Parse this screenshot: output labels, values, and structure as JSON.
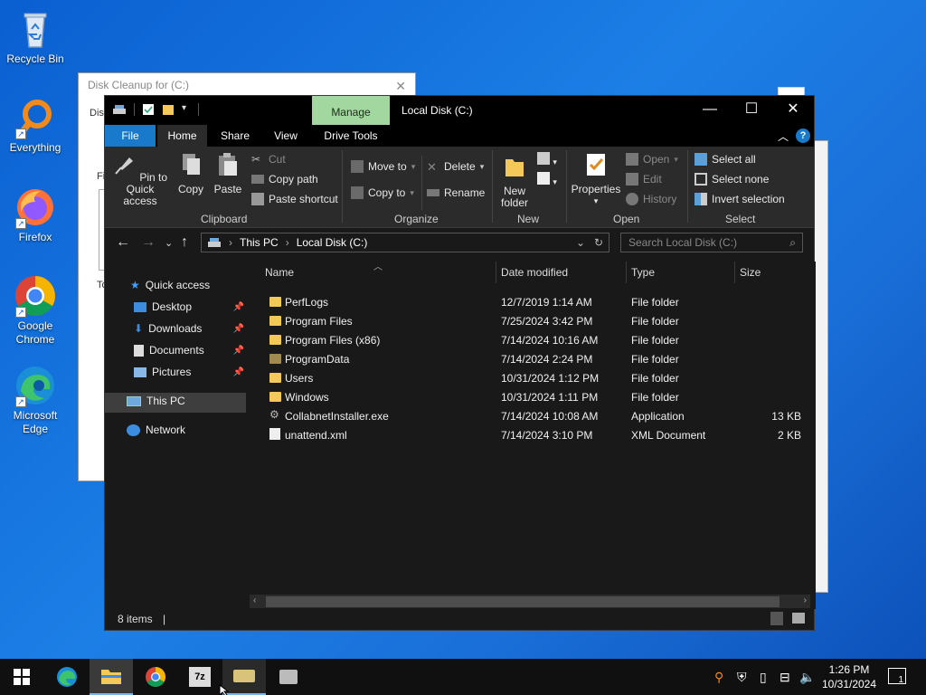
{
  "desktop": {
    "icons": [
      {
        "label": "Recycle Bin"
      },
      {
        "label": "Everything"
      },
      {
        "label": "Firefox"
      },
      {
        "label": "Google Chrome"
      },
      {
        "label": "Microsoft Edge"
      }
    ]
  },
  "background_window": {
    "title": "Disk Cleanup for (C:)",
    "fragments": [
      "Dis",
      "Fi",
      "To"
    ]
  },
  "explorer": {
    "context_tab": "Manage",
    "title": "Local Disk (C:)",
    "tabs": [
      "File",
      "Home",
      "Share",
      "View",
      "Drive Tools"
    ],
    "ribbon": {
      "clipboard": {
        "label": "Clipboard",
        "pin": "Pin to Quick access",
        "copy": "Copy",
        "paste": "Paste",
        "cut": "Cut",
        "copy_path": "Copy path",
        "paste_shortcut": "Paste shortcut"
      },
      "organize": {
        "label": "Organize",
        "move_to": "Move to",
        "copy_to": "Copy to",
        "delete": "Delete",
        "rename": "Rename"
      },
      "new": {
        "label": "New",
        "new_folder": "New folder"
      },
      "open": {
        "label": "Open",
        "properties": "Properties",
        "open": "Open",
        "edit": "Edit",
        "history": "History"
      },
      "select": {
        "label": "Select",
        "select_all": "Select all",
        "select_none": "Select none",
        "invert": "Invert selection"
      }
    },
    "address": {
      "crumbs": [
        "This PC",
        "Local Disk (C:)"
      ],
      "search_placeholder": "Search Local Disk (C:)"
    },
    "nav": {
      "quick_access": "Quick access",
      "desktop": "Desktop",
      "downloads": "Downloads",
      "documents": "Documents",
      "pictures": "Pictures",
      "this_pc": "This PC",
      "network": "Network"
    },
    "columns": [
      "Name",
      "Date modified",
      "Type",
      "Size"
    ],
    "files": [
      {
        "name": "PerfLogs",
        "date": "12/7/2019 1:14 AM",
        "type": "File folder",
        "size": "",
        "kind": "folder"
      },
      {
        "name": "Program Files",
        "date": "7/25/2024 3:42 PM",
        "type": "File folder",
        "size": "",
        "kind": "folder"
      },
      {
        "name": "Program Files (x86)",
        "date": "7/14/2024 10:16 AM",
        "type": "File folder",
        "size": "",
        "kind": "folder"
      },
      {
        "name": "ProgramData",
        "date": "7/14/2024 2:24 PM",
        "type": "File folder",
        "size": "",
        "kind": "hidden-folder"
      },
      {
        "name": "Users",
        "date": "10/31/2024 1:12 PM",
        "type": "File folder",
        "size": "",
        "kind": "folder"
      },
      {
        "name": "Windows",
        "date": "10/31/2024 1:11 PM",
        "type": "File folder",
        "size": "",
        "kind": "folder"
      },
      {
        "name": "CollabnetInstaller.exe",
        "date": "7/14/2024 10:08 AM",
        "type": "Application",
        "size": "13 KB",
        "kind": "exe"
      },
      {
        "name": "unattend.xml",
        "date": "7/14/2024 3:10 PM",
        "type": "XML Document",
        "size": "2 KB",
        "kind": "xml"
      }
    ],
    "status": "8 items"
  },
  "taskbar": {
    "time": "1:26 PM",
    "date": "10/31/2024",
    "notification_count": "1"
  },
  "colors": {
    "accent": "#1979ca",
    "manage_tab": "#a3d7a0"
  }
}
